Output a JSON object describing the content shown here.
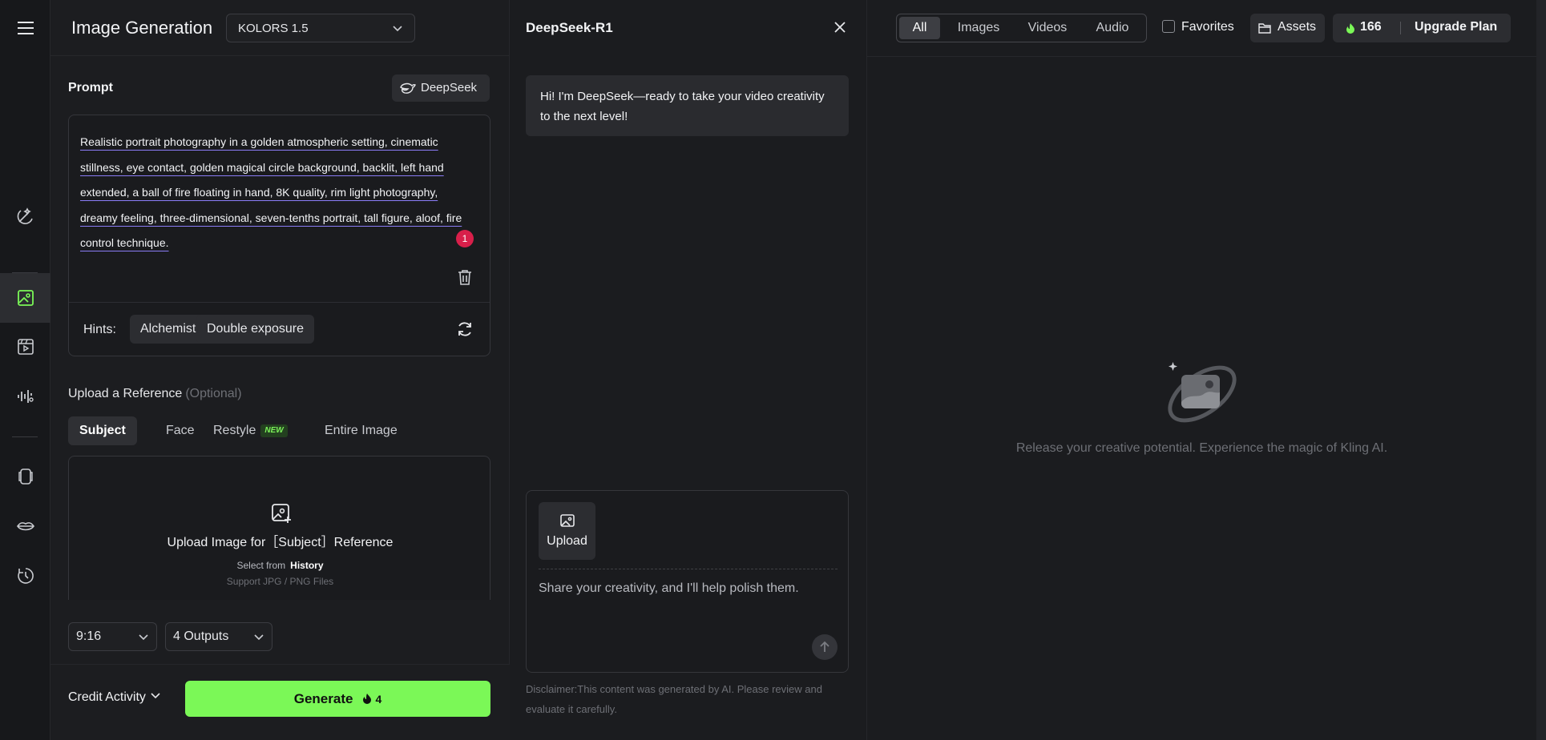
{
  "rail": {
    "icons": [
      "menu-icon",
      "sparkle-edit-icon",
      "image-icon",
      "video-icon",
      "audio-icon",
      "character-icon",
      "lips-icon",
      "history-icon"
    ],
    "active": "image-icon",
    "accent": "#7bf857"
  },
  "generator": {
    "title": "Image Generation",
    "model": "KOLORS 1.5",
    "prompt_label": "Prompt",
    "deepseek_label": "DeepSeek",
    "prompt_text": "Realistic portrait photography in a golden atmospheric setting, cinematic stillness, eye contact, golden magical circle background, backlit, left hand extended, a ball of fire floating in hand, 8K quality, rim light photography, dreamy feeling, three-dimensional, seven-tenths portrait, tall figure, aloof, fire control technique.",
    "issue_count": "1",
    "hints_label": "Hints:",
    "hints": [
      "Alchemist",
      "Double exposure"
    ],
    "reference_label": "Upload a Reference",
    "reference_optional": "(Optional)",
    "reference_tabs": [
      "Subject",
      "Face",
      "Restyle",
      "Entire Image"
    ],
    "new_badge": "NEW",
    "upload_title": "Upload Image for［Subject］Reference",
    "select_from": "Select from",
    "history_link": "History",
    "support_text": "Support JPG / PNG Files",
    "aspect_ratio": "9:16",
    "outputs": "4 Outputs",
    "credit_activity": "Credit Activity",
    "generate_label": "Generate",
    "generate_cost": "4"
  },
  "chat": {
    "title": "DeepSeek-R1",
    "greeting": "Hi! I'm DeepSeek—ready to take your video creativity to the next level!",
    "upload_label": "Upload",
    "input_placeholder": "Share your creativity, and I'll help polish them.",
    "disclaimer": "Disclaimer:This content was generated by AI. Please review and evaluate it carefully."
  },
  "topbar": {
    "filters": [
      "All",
      "Images",
      "Videos",
      "Audio"
    ],
    "active_filter": "All",
    "favorites_label": "Favorites",
    "assets_label": "Assets",
    "credits": "166",
    "upgrade_label": "Upgrade Plan"
  },
  "empty_state": {
    "message": "Release your creative potential. Experience the magic of Kling AI."
  }
}
